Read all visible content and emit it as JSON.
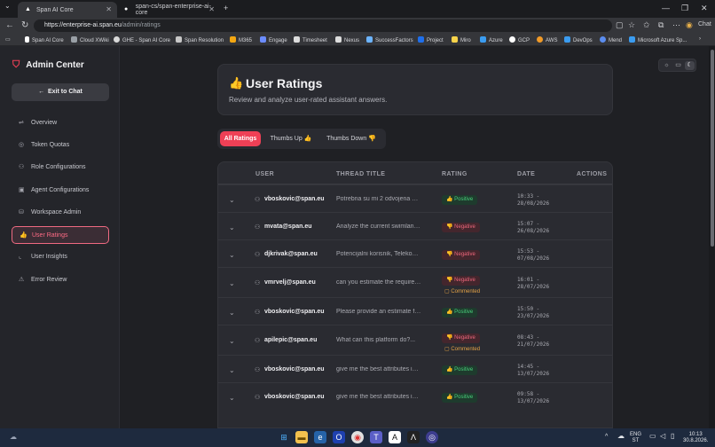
{
  "browser": {
    "tabs": [
      {
        "title": "Span AI Core",
        "active": true
      },
      {
        "title": "span-cs/span-enterprise-ai-core",
        "active": false
      }
    ],
    "url_host": "https://enterprise-ai.span.eu",
    "url_path": "/admin/ratings",
    "profile_label": "Chat",
    "bookmarks": [
      "Span AI Core",
      "Cloud XWiki",
      "GHE - Span AI Core",
      "Span Resolution",
      "M365",
      "Engage",
      "Timesheet",
      "Nexus",
      "SuccessFactors",
      "Project",
      "Miro",
      "Azure",
      "GCP",
      "AWS",
      "DevOps",
      "Mend",
      "Microsoft Azure Sp..."
    ]
  },
  "sidebar": {
    "title": "Admin Center",
    "exit_label": "Exit to Chat",
    "items": [
      {
        "label": "Overview",
        "icon": "sliders-icon"
      },
      {
        "label": "Token Quotas",
        "icon": "coins-icon"
      },
      {
        "label": "Role Configurations",
        "icon": "users-icon"
      },
      {
        "label": "Agent Configurations",
        "icon": "bot-icon"
      },
      {
        "label": "Workspace Admin",
        "icon": "database-icon"
      },
      {
        "label": "User Ratings",
        "icon": "thumbs-up-icon",
        "active": true
      },
      {
        "label": "User Insights",
        "icon": "chart-icon"
      },
      {
        "label": "Error Review",
        "icon": "warning-icon"
      }
    ]
  },
  "header": {
    "title": "User Ratings",
    "subtitle": "Review and analyze user-rated assistant answers."
  },
  "filters": {
    "all": "All Ratings",
    "up": "Thumbs Up 👍",
    "down": "Thumbs Down 👎"
  },
  "table": {
    "columns": [
      "USER",
      "THREAD TITLE",
      "RATING",
      "DATE",
      "ACTIONS"
    ],
    "rows": [
      {
        "user": "vboskovic@span.eu",
        "title": "Potrebna su mi 2 odvojena Sta...",
        "rating": "Positive",
        "commented": "",
        "time": "10:33 -",
        "date": "28/08/2026"
      },
      {
        "user": "mvata@span.eu",
        "title": "Analyze the current swimlane ...",
        "rating": "Negative",
        "commented": "",
        "time": "15:07 -",
        "date": "26/08/2026"
      },
      {
        "user": "djkrivak@span.eu",
        "title": "Potencijalni korisnik, Telekom ...",
        "rating": "Negative",
        "commented": "",
        "time": "15:53 -",
        "date": "07/08/2026"
      },
      {
        "user": "vmrvelj@span.eu",
        "title": "can you estimate the required ...",
        "rating": "Negative",
        "commented": "Commented",
        "time": "16:01 -",
        "date": "28/07/2026"
      },
      {
        "user": "vboskovic@span.eu",
        "title": "Please provide an estimate for ...",
        "rating": "Positive",
        "commented": "",
        "time": "15:50 -",
        "date": "23/07/2026"
      },
      {
        "user": "apilepic@span.eu",
        "title": "What can this platform do?...",
        "rating": "Negative",
        "commented": "Commented",
        "time": "08:43 -",
        "date": "21/07/2026"
      },
      {
        "user": "vboskovic@span.eu",
        "title": "give me the best attributes in ...",
        "rating": "Positive",
        "commented": "",
        "time": "14:45 -",
        "date": "13/07/2026"
      },
      {
        "user": "vboskovic@span.eu",
        "title": "give me the best attributes in ...",
        "rating": "Positive",
        "commented": "",
        "time": "09:58 -",
        "date": "13/07/2026"
      }
    ]
  },
  "taskbar": {
    "lang_top": "ENG",
    "lang_bottom": "ST",
    "time": "10:13",
    "date": "30.8.2026."
  }
}
